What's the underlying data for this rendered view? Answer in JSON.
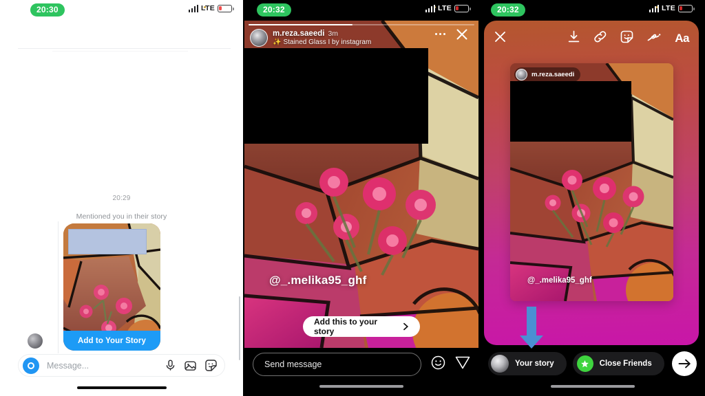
{
  "meta": {
    "panels": 3
  },
  "colors": {
    "time_badge": "#2ec45f",
    "accent_blue": "#1d9bf6",
    "close_friends_green": "#3fd43f",
    "annotation_arrow": "#4b8fd3",
    "redaction_blue": "#b4c3e0",
    "redaction_black": "#000000"
  },
  "panel1": {
    "status": {
      "time": "20:30",
      "network": "LTE"
    },
    "message_timestamp": "20:29",
    "mention_label": "Mentioned you in their story",
    "story_card_cta": "Add to Your Story",
    "composer": {
      "placeholder": "Message...",
      "icons": [
        "camera-icon",
        "microphone-icon",
        "photo-icon",
        "sticker-icon"
      ]
    }
  },
  "panel2": {
    "status": {
      "time": "20:32",
      "network": "LTE"
    },
    "story": {
      "username": "m.reza.saeedi",
      "age": "3m",
      "effect": "Stained Glass I by instagram",
      "effect_prefix": "✨",
      "mention": "@_.melika95_ghf",
      "add_button": "Add this to your story",
      "progress_percent": 46
    },
    "reply": {
      "placeholder": "Send message",
      "icons": [
        "emoji-icon",
        "send-icon"
      ]
    },
    "header_icons": [
      "more-options-icon",
      "close-icon"
    ]
  },
  "panel3": {
    "status": {
      "time": "20:32",
      "network": "LTE"
    },
    "toolbar": {
      "close": "close-icon",
      "tools": [
        "download-icon",
        "link-icon",
        "sticker-icon",
        "draw-icon",
        "text-icon"
      ],
      "text_label": "Aa"
    },
    "card": {
      "username": "m.reza.saeedi",
      "mention": "@_.melika95_ghf"
    },
    "share": {
      "your_story": "Your story",
      "close_friends": "Close Friends",
      "next": "next-arrow-icon"
    },
    "annotation": "down-arrow-annotation"
  }
}
